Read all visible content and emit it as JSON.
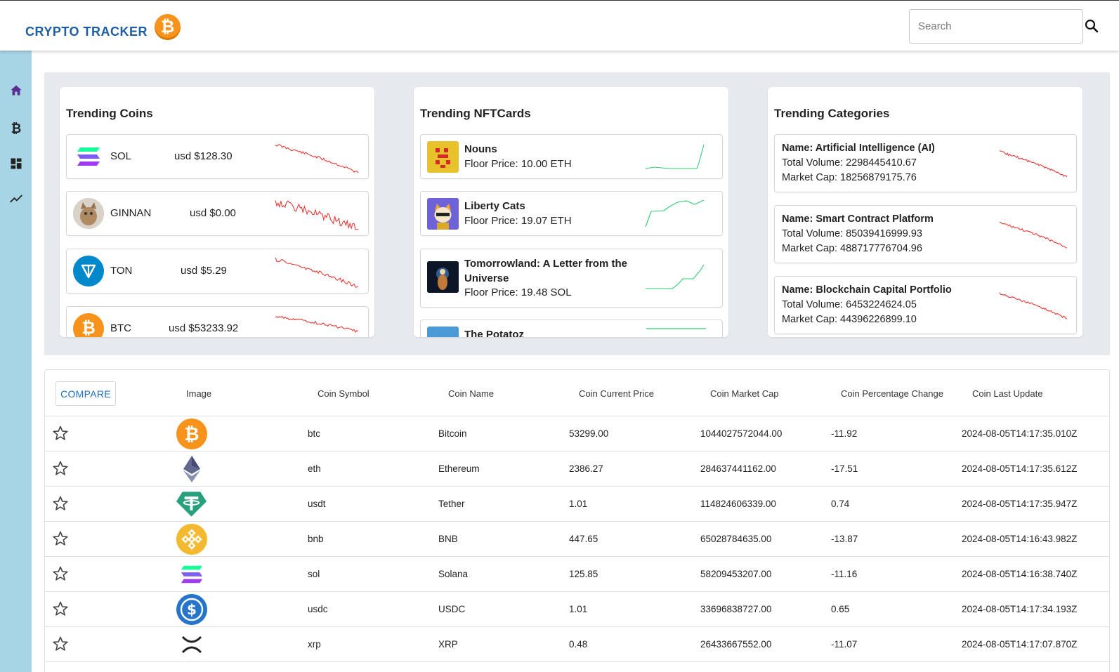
{
  "header": {
    "title": "CRYPTO TRACKER",
    "logo_glyph": "₿",
    "search_placeholder": "Search"
  },
  "sidebar": {
    "items": [
      "home-icon",
      "bitcoin-icon",
      "dashboard-icon",
      "trending-icon"
    ],
    "accent": "#5b2d8e"
  },
  "trending_coins": {
    "title": "Trending Coins",
    "items": [
      {
        "symbol": "SOL",
        "price": "usd $128.30"
      },
      {
        "symbol": "GINNAN",
        "price": "usd $0.00"
      },
      {
        "symbol": "TON",
        "price": "usd $5.29"
      },
      {
        "symbol": "BTC",
        "price": "usd $53233.92"
      }
    ]
  },
  "trending_nfts": {
    "title": "Trending NFTCards",
    "items": [
      {
        "name": "Nouns",
        "floor": "Floor Price: 10.00 ETH"
      },
      {
        "name": "Liberty Cats",
        "floor": "Floor Price: 19.07 ETH"
      },
      {
        "name": "Tomorrowland: A Letter from the Universe",
        "floor": "Floor Price: 19.48 SOL"
      },
      {
        "name": "The Potatoz",
        "floor": ""
      }
    ]
  },
  "trending_categories": {
    "title": "Trending Categories",
    "items": [
      {
        "name": "Name: Artificial Intelligence (AI)",
        "volume": "Total Volume: 2298445410.67",
        "cap": "Market Cap: 18256879175.76"
      },
      {
        "name": "Name: Smart Contract Platform",
        "volume": "Total Volume: 85039416999.93",
        "cap": "Market Cap: 488717776704.96"
      },
      {
        "name": "Name: Blockchain Capital Portfolio",
        "volume": "Total Volume: 6453224624.05",
        "cap": "Market Cap: 44396226899.10"
      }
    ]
  },
  "table": {
    "compare_label": "COMPARE",
    "headers": [
      "Image",
      "Coin Symbol",
      "Coin Name",
      "Coin Current Price",
      "Coin Market Cap",
      "Coin Percentage Change",
      "Coin Last Update"
    ],
    "rows": [
      {
        "icon": "btc",
        "symbol": "btc",
        "name": "Bitcoin",
        "price": "53299.00",
        "cap": "1044027572044.00",
        "change": "-11.92",
        "updated": "2024-08-05T14:17:35.010Z"
      },
      {
        "icon": "eth",
        "symbol": "eth",
        "name": "Ethereum",
        "price": "2386.27",
        "cap": "284637441162.00",
        "change": "-17.51",
        "updated": "2024-08-05T14:17:35.612Z"
      },
      {
        "icon": "usdt",
        "symbol": "usdt",
        "name": "Tether",
        "price": "1.01",
        "cap": "114824606339.00",
        "change": "0.74",
        "updated": "2024-08-05T14:17:35.947Z"
      },
      {
        "icon": "bnb",
        "symbol": "bnb",
        "name": "BNB",
        "price": "447.65",
        "cap": "65028784635.00",
        "change": "-13.87",
        "updated": "2024-08-05T14:16:43.982Z"
      },
      {
        "icon": "sol",
        "symbol": "sol",
        "name": "Solana",
        "price": "125.85",
        "cap": "58209453207.00",
        "change": "-11.16",
        "updated": "2024-08-05T14:16:38.740Z"
      },
      {
        "icon": "usdc",
        "symbol": "usdc",
        "name": "USDC",
        "price": "1.01",
        "cap": "33696838727.00",
        "change": "0.65",
        "updated": "2024-08-05T14:17:34.193Z"
      },
      {
        "icon": "xrp",
        "symbol": "xrp",
        "name": "XRP",
        "price": "0.48",
        "cap": "26433667552.00",
        "change": "-11.07",
        "updated": "2024-08-05T14:17:07.870Z"
      }
    ]
  },
  "colors": {
    "brand": "#1e5fa3",
    "sidebar": "#a8d5e6",
    "spark_down": "#e53935",
    "spark_up": "#2ecc71",
    "panel": "#e6e9ee"
  }
}
